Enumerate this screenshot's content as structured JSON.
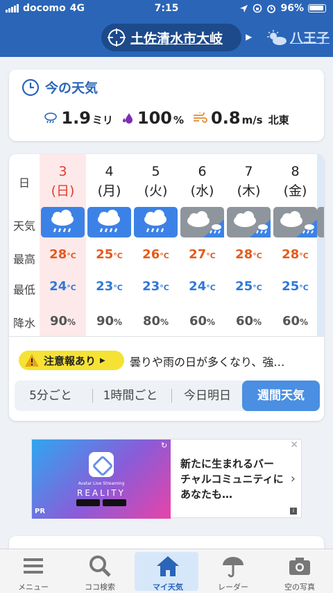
{
  "status_bar": {
    "carrier": "docomo",
    "network": "4G",
    "time": "7:15",
    "battery": "96%"
  },
  "header": {
    "current_location": "土佐清水市大岐",
    "next_location": "八王子"
  },
  "now": {
    "title": "今の天気",
    "precip_value": "1.9",
    "precip_unit": "ミリ",
    "humidity_value": "100",
    "humidity_unit": "%",
    "wind_value": "0.8",
    "wind_unit": "m/s",
    "wind_dir": "北東"
  },
  "week": {
    "row_labels": [
      "日",
      "天気",
      "最高",
      "最低",
      "降水"
    ],
    "days": [
      {
        "day": "3",
        "weekday": "(日)",
        "weather_icon": "rain-cloud-icon",
        "high": "28",
        "low": "24",
        "precip": "90",
        "today": true
      },
      {
        "day": "4",
        "weekday": "(月)",
        "weather_icon": "rain-cloud-icon",
        "high": "25",
        "low": "23",
        "precip": "90",
        "today": false
      },
      {
        "day": "5",
        "weekday": "(火)",
        "weather_icon": "rain-cloud-icon",
        "high": "26",
        "low": "23",
        "precip": "80",
        "today": false
      },
      {
        "day": "6",
        "weekday": "(水)",
        "weather_icon": "cloud-rain-icon",
        "high": "27",
        "low": "24",
        "precip": "60",
        "today": false
      },
      {
        "day": "7",
        "weekday": "(木)",
        "weather_icon": "cloud-rain-icon",
        "high": "28",
        "low": "25",
        "precip": "60",
        "today": false
      },
      {
        "day": "8",
        "weekday": "(金)",
        "weather_icon": "cloud-rain-icon",
        "high": "28",
        "low": "25",
        "precip": "60",
        "today": false
      }
    ],
    "temp_unit": "°C",
    "precip_unit": "%"
  },
  "alert": {
    "badge": "注意報あり",
    "text": "曇りや雨の日が多くなり、強…"
  },
  "tabs": [
    "5分ごと",
    "1時間ごと",
    "今日明日",
    "週間天気"
  ],
  "active_tab": "週間天気",
  "ad": {
    "small_text": "Avatar Live Streaming",
    "brand": "REALITY",
    "label": "PR",
    "text": "新たに生まれるバーチャルコミュニティにあなたも…"
  },
  "nav": [
    {
      "label": "メニュー",
      "icon": "menu-icon"
    },
    {
      "label": "ココ検索",
      "icon": "search-icon"
    },
    {
      "label": "マイ天気",
      "icon": "home-icon",
      "active": true
    },
    {
      "label": "レーダー",
      "icon": "umbrella-icon"
    },
    {
      "label": "空の写真",
      "icon": "camera-icon"
    }
  ],
  "colors": {
    "header_blue": "#2a65b8",
    "rain_icon_bg": "#3c82e6",
    "cloud_icon_bg": "#8f959c",
    "high_temp": "#e45a1c",
    "low_temp": "#2f78d8",
    "today_red": "#e23b2e",
    "alert_yellow": "#f5e234"
  }
}
